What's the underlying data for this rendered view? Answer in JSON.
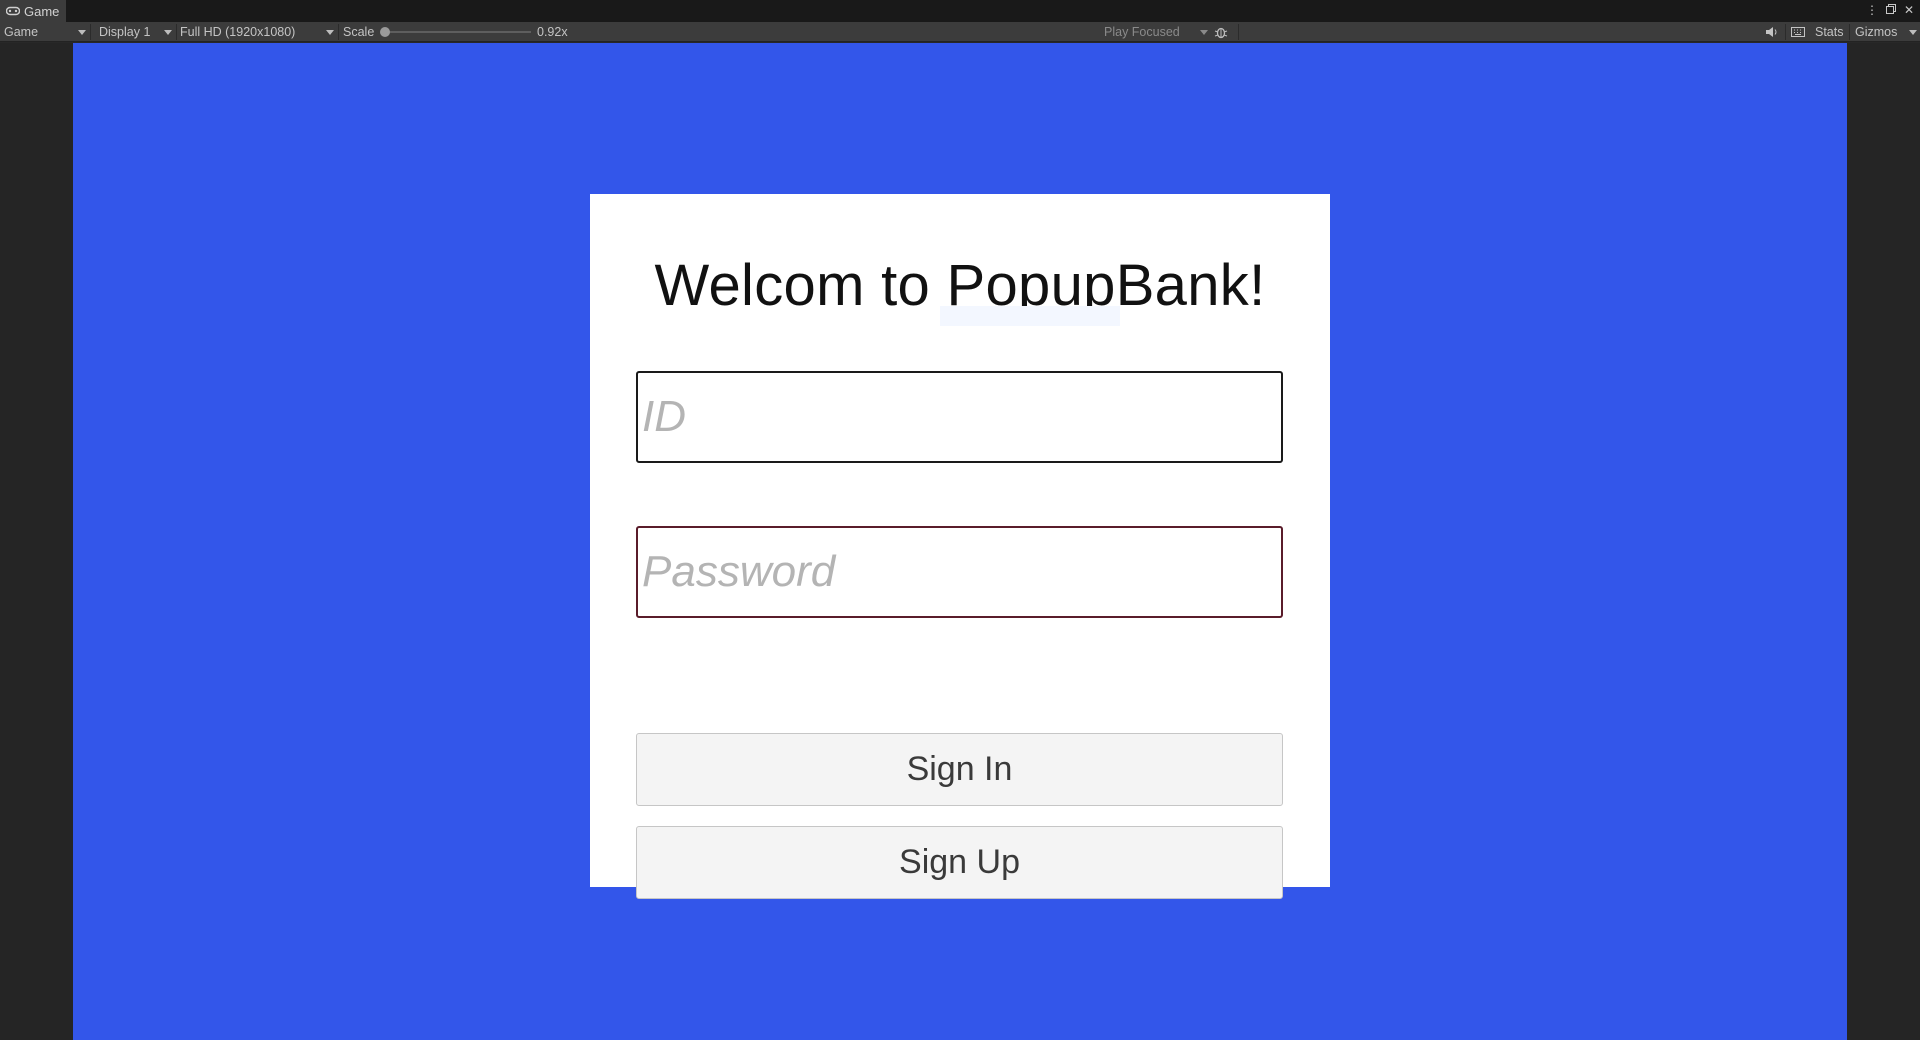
{
  "editor": {
    "tab_label": "Game",
    "tab_icon": "gamepad-icon",
    "window_controls": [
      "more-icon",
      "maximize-icon",
      "close-icon"
    ]
  },
  "toolbar": {
    "mode": "Game",
    "display": "Display 1",
    "resolution": "Full HD (1920x1080)",
    "scale_label": "Scale",
    "scale_value": "0.92x",
    "scale_level": 0.0,
    "play_focused": "Play Focused",
    "stats": "Stats",
    "gizmos": "Gizmos"
  },
  "game": {
    "background_color": "#3356ea",
    "panel_color": "#ffffff",
    "title": "Welcom to PopupBank!",
    "id_placeholder": "ID",
    "password_placeholder": "Password",
    "sign_in_label": "Sign In",
    "sign_up_label": "Sign Up"
  }
}
